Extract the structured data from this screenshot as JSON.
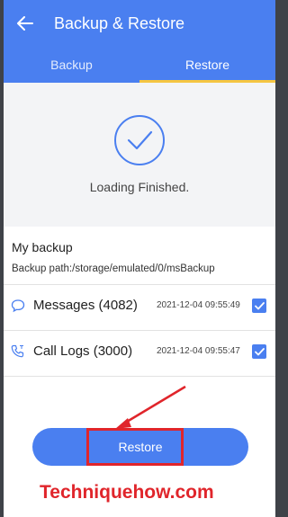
{
  "appbar": {
    "title": "Backup & Restore",
    "back_icon": "arrow-left-icon"
  },
  "tabs": [
    {
      "label": "Backup",
      "active": false
    },
    {
      "label": "Restore",
      "active": true
    }
  ],
  "status": {
    "text": "Loading Finished.",
    "icon": "checkmark-circle-icon"
  },
  "backup": {
    "title": "My backup",
    "path": "Backup path:/storage/emulated/0/msBackup",
    "items": [
      {
        "label": "Messages (4082)",
        "time": "2021-12-04 09:55:49",
        "checked": true,
        "icon": "message-bubble-icon"
      },
      {
        "label": "Call Logs (3000)",
        "time": "2021-12-04 09:55:47",
        "checked": true,
        "icon": "phone-icon"
      }
    ]
  },
  "actions": {
    "restore_label": "Restore"
  },
  "watermark": "Techniquehow.com",
  "colors": {
    "primary": "#4a7ff0",
    "tab_indicator": "#f5c542",
    "annotation": "#e0252b"
  }
}
